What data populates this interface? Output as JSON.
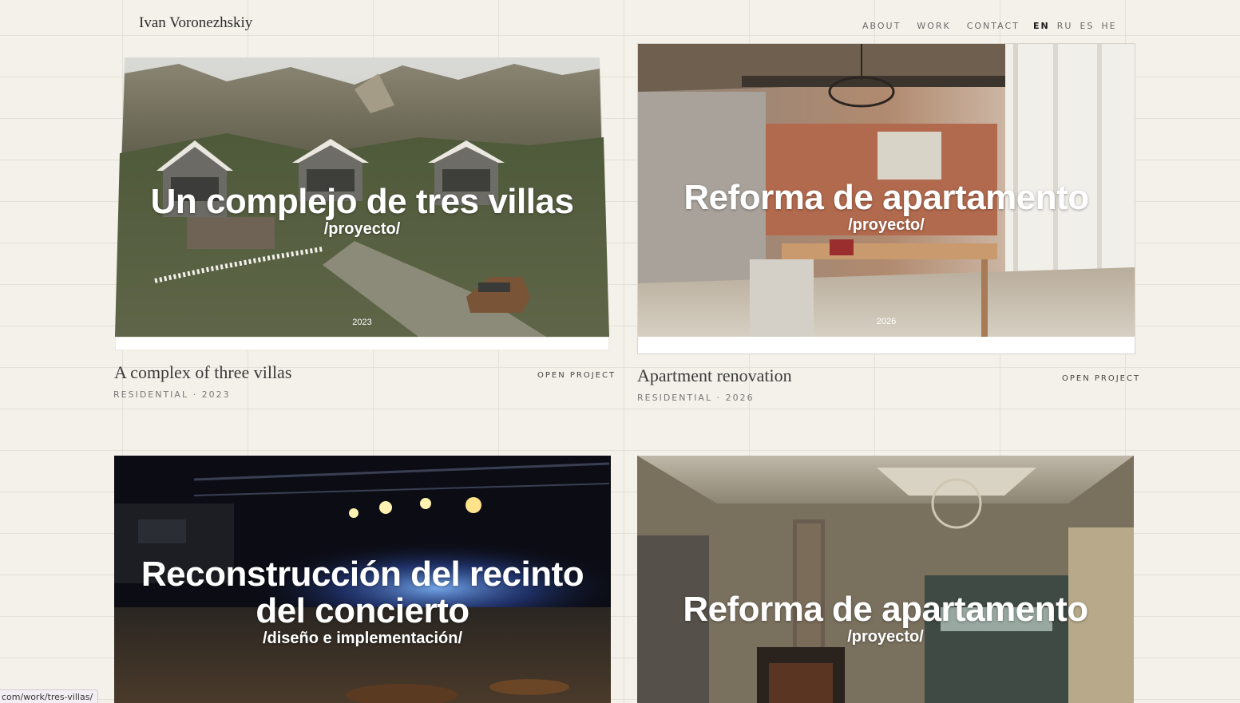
{
  "site_name": "Ivan Voronezhskiy",
  "nav": {
    "about": "ABOUT",
    "work": "WORK",
    "contact": "CONTACT"
  },
  "languages": {
    "en": "EN",
    "ru": "RU",
    "es": "ES",
    "he": "HE",
    "active": "EN"
  },
  "projects": [
    {
      "overlay_title": "Un complejo de tres villas",
      "overlay_subtitle": "/proyecto/",
      "overlay_year": "2023",
      "title": "A complex of three villas",
      "meta": "RESIDENTIAL · 2023",
      "open_label": "OPEN PROJECT"
    },
    {
      "overlay_title": "Reforma de apartamento",
      "overlay_subtitle": "/proyecto/",
      "overlay_year": "2026",
      "title": "Apartment renovation",
      "meta": "RESIDENTIAL · 2026",
      "open_label": "OPEN PROJECT"
    },
    {
      "overlay_title_line1": "Reconstrucción del recinto",
      "overlay_title_line2": "del concierto",
      "overlay_subtitle": "/diseño e implementación/"
    },
    {
      "overlay_title": "Reforma de apartamento",
      "overlay_subtitle": "/proyecto/"
    }
  ],
  "status_bar_url": "com/work/tres-villas/"
}
